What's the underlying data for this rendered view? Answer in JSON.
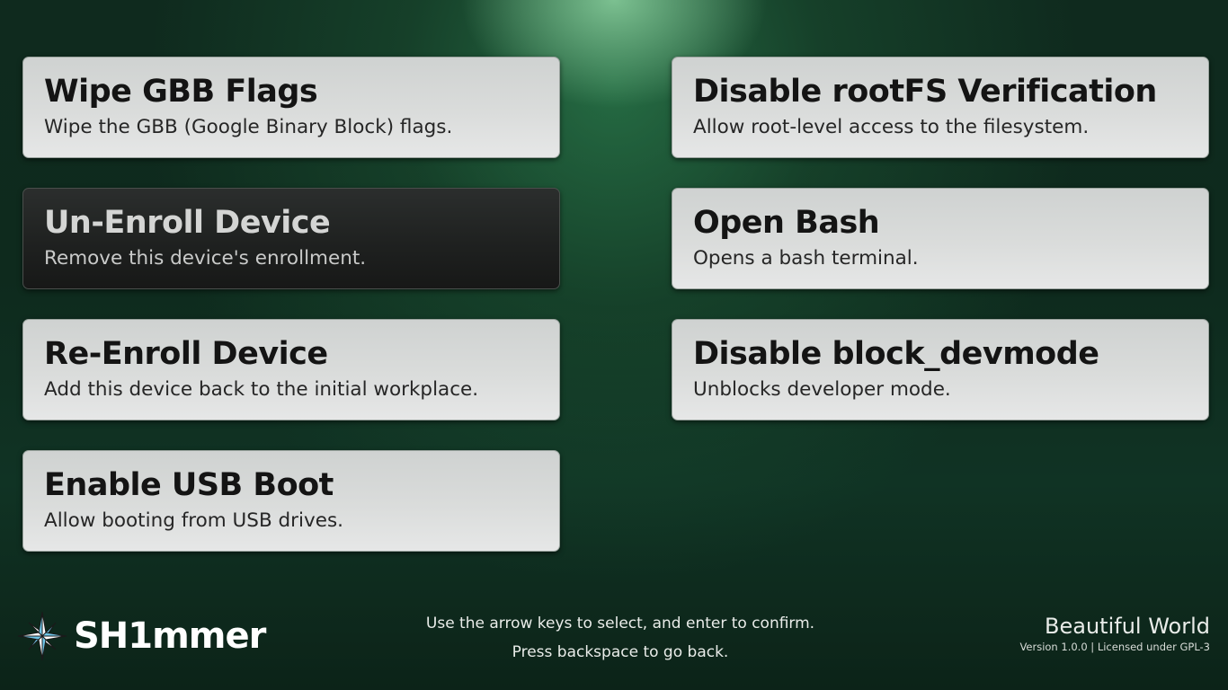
{
  "menu": {
    "items": [
      {
        "title": "Wipe GBB Flags",
        "description": "Wipe the GBB (Google Binary Block) flags.",
        "selected": false
      },
      {
        "title": "Disable rootFS Verification",
        "description": "Allow root-level access to the filesystem.",
        "selected": false
      },
      {
        "title": "Un-Enroll Device",
        "description": "Remove this device's enrollment.",
        "selected": true
      },
      {
        "title": "Open Bash",
        "description": "Opens a bash terminal.",
        "selected": false
      },
      {
        "title": "Re-Enroll Device",
        "description": "Add this device back to the initial workplace.",
        "selected": false
      },
      {
        "title": "Disable block_devmode",
        "description": "Unblocks developer mode.",
        "selected": false
      },
      {
        "title": "Enable USB Boot",
        "description": "Allow booting from USB drives.",
        "selected": false
      }
    ]
  },
  "footer": {
    "logo_text": "SH1mmer",
    "logo_icon": "compass-star-icon",
    "instructions": [
      "Use the arrow keys to select, and enter to confirm.",
      "Press backspace to go back."
    ],
    "theme_name": "Beautiful World",
    "version_text": "Version 1.0.0 | Licensed under GPL-3"
  },
  "colors": {
    "card_light": "#dadcdb",
    "card_selected": "#1f2120",
    "background": "#0f2a1e",
    "accent_glow": "#8cd2a0",
    "logo_star_blue": "#6ec6e8"
  }
}
